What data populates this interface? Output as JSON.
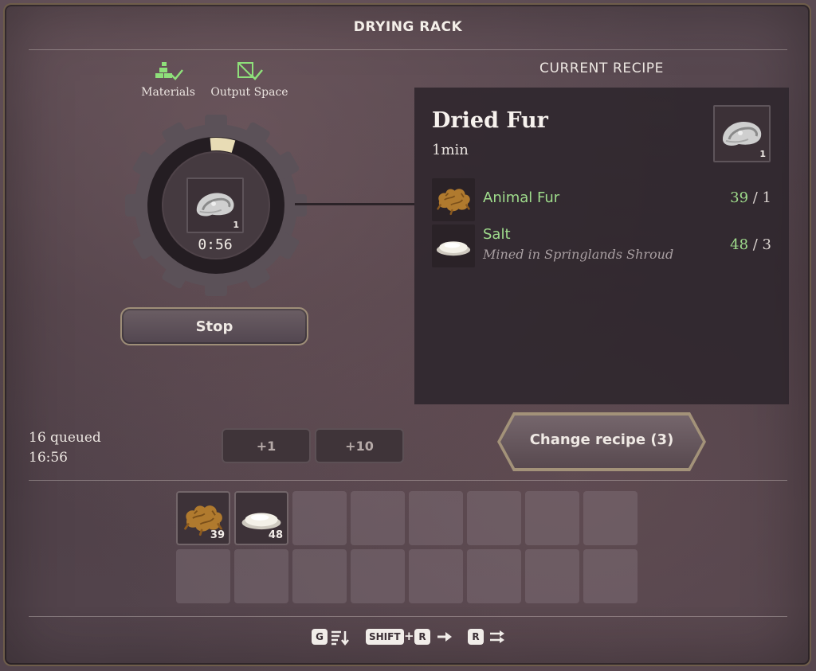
{
  "window": {
    "title": "DRYING RACK"
  },
  "status": {
    "materials": {
      "label": "Materials",
      "icon": "materials-check-icon",
      "ok": true
    },
    "output_space": {
      "label": "Output Space",
      "icon": "output-space-check-icon",
      "ok": true
    }
  },
  "crafting": {
    "item_count": "1",
    "timer": "0:56",
    "progress": 0.06,
    "stop_label": "Stop"
  },
  "queue": {
    "queued_text": "16 queued",
    "total_time": "16:56",
    "add_one_label": "+1",
    "add_ten_label": "+10"
  },
  "change_recipe_label": "Change recipe (3)",
  "recipe": {
    "header": "CURRENT RECIPE",
    "name": "Dried Fur",
    "time": "1min",
    "output_count": "1",
    "ingredients": [
      {
        "name": "Animal Fur",
        "have": "39",
        "need": "1",
        "icon": "animal-fur-icon"
      },
      {
        "name": "Salt",
        "subtitle": "Mined in Springlands Shroud",
        "have": "48",
        "need": "3",
        "icon": "salt-icon"
      }
    ]
  },
  "inventory": [
    {
      "item": "animal-fur-icon",
      "count": "39"
    },
    {
      "item": "salt-icon",
      "count": "48"
    }
  ],
  "keyhints": {
    "g_key": "G",
    "shift_key": "SHIFT",
    "plus": "+",
    "r_key": "R",
    "r_key2": "R",
    "sort_icon": "sort-icon",
    "arrow_icon": "arrow-right-icon",
    "swap_icon": "swap-icon"
  },
  "colors": {
    "have_enough": "#9fdc8c",
    "progress": "#e8dcb5",
    "gold_trim": "#a39279"
  }
}
